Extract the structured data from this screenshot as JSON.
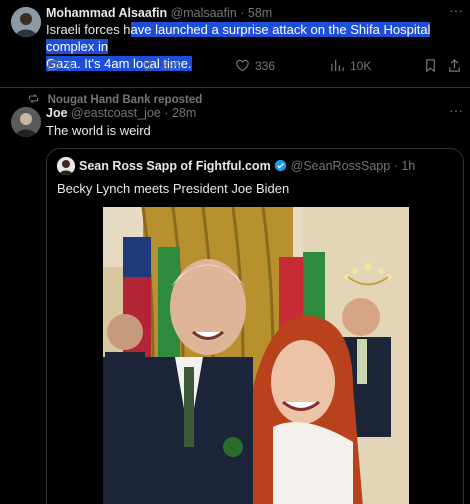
{
  "post1": {
    "author": "Mohammad Alsaafin",
    "handle": "@malsaafin",
    "time": "· 58m",
    "text_plain": "Israeli forces h",
    "text_highlight_line1": "ave launched a surprise attack on the Shifa Hospital complex in",
    "text_highlight_line2": "Gaza. It's 4am local time.",
    "actions": {
      "replies": "5",
      "reposts": "335",
      "likes": "336",
      "views": "10K"
    }
  },
  "repost_note": "Nougat Hand Bank reposted",
  "post2": {
    "author": "Joe",
    "handle": "@eastcoast_joe",
    "time": "· 28m",
    "text": "The world is weird"
  },
  "quoted": {
    "author": "Sean Ross Sapp of Fightful.com",
    "handle": "@SeanRossSapp",
    "time": "· 1h",
    "text": "Becky Lynch meets President Joe Biden"
  },
  "colors": {
    "background": "#000000",
    "muted": "#71767b",
    "verified": "#1d9bf0",
    "highlight": "#1d4ed8"
  }
}
